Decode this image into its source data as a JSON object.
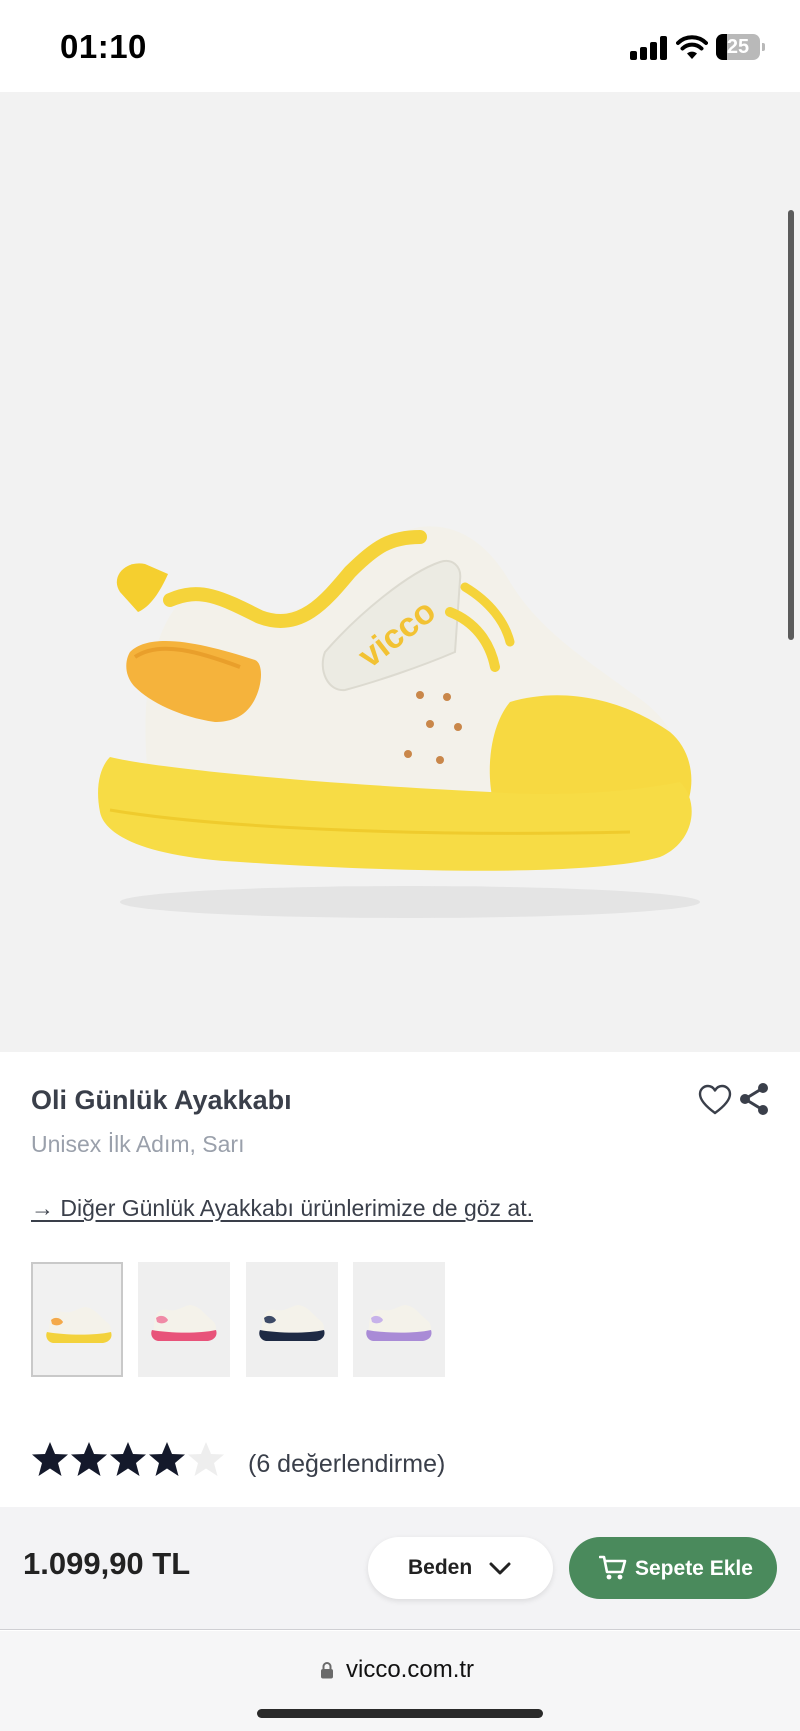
{
  "status_bar": {
    "time": "01:10",
    "battery_level": "25",
    "signal_icon": "cellular-signal-icon",
    "wifi_icon": "wifi-icon",
    "battery_icon": "battery-icon"
  },
  "gallery": {
    "image_label": "vicco",
    "image_position_fraction": 0.125
  },
  "product": {
    "title": "Oli Günlük Ayakkabı",
    "subtitle": "Unisex İlk Adım, Sarı",
    "other_products_link": "→ Diğer Günlük Ayakkabı ürünlerimize de göz at."
  },
  "variants": [
    {
      "color": "#f3d23c",
      "accent": "#f4a94a",
      "selected": true
    },
    {
      "color": "#e8537a",
      "accent": "#f08aa6",
      "selected": false
    },
    {
      "color": "#1e2a44",
      "accent": "#3d4a66",
      "selected": false
    },
    {
      "color": "#a98bd6",
      "accent": "#c7b2ea",
      "selected": false
    }
  ],
  "rating": {
    "stars": 4,
    "max_stars": 5,
    "count_text": "(6 değerlendirme)"
  },
  "purchase": {
    "price": "1.099,90 TL",
    "size_label": "Beden",
    "add_to_cart_label": "Sepete Ekle",
    "accent_color": "#4a8a5c"
  },
  "browser": {
    "url": "vicco.com.tr"
  }
}
